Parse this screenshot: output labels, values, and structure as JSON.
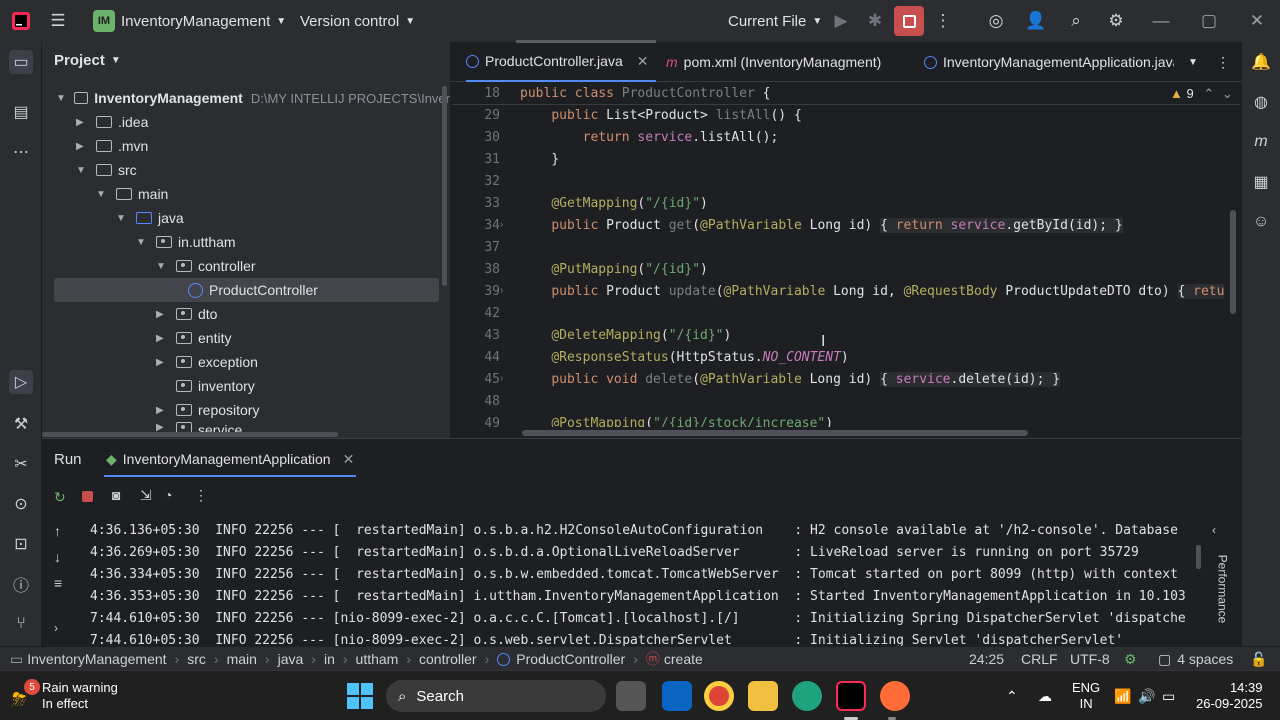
{
  "titlebar": {
    "project": "InventoryManagement",
    "project_badge": "IM",
    "vcs": "Version control",
    "run_config": "Current File"
  },
  "project_panel": {
    "title": "Project",
    "items": [
      {
        "label": "InventoryManagement",
        "path": "D:\\MY INTELLIJ PROJECTS\\Inver"
      },
      {
        "label": ".idea"
      },
      {
        "label": ".mvn"
      },
      {
        "label": "src"
      },
      {
        "label": "main"
      },
      {
        "label": "java"
      },
      {
        "label": "in.uttham"
      },
      {
        "label": "controller"
      },
      {
        "label": "ProductController"
      },
      {
        "label": "dto"
      },
      {
        "label": "entity"
      },
      {
        "label": "exception"
      },
      {
        "label": "inventory"
      },
      {
        "label": "repository"
      },
      {
        "label": "service"
      }
    ]
  },
  "tabs": [
    {
      "label": "ProductController.java"
    },
    {
      "label": "pom.xml (InventoryManagment)"
    },
    {
      "label": "InventoryManagementApplication.java"
    }
  ],
  "editor": {
    "warnings": "9",
    "sticky_line": "18",
    "sticky_code": "public class ProductController {",
    "lines": [
      {
        "n": "29",
        "code": "    public List<Product> listAll() {"
      },
      {
        "n": "30",
        "code": "        return service.listAll();"
      },
      {
        "n": "31",
        "code": "    }"
      },
      {
        "n": "32",
        "code": ""
      },
      {
        "n": "33",
        "code": "    @GetMapping(\"/{id}\")"
      },
      {
        "n": "34",
        "code": "    public Product get(@PathVariable Long id) { return service.getById(id); }"
      },
      {
        "n": "37",
        "code": ""
      },
      {
        "n": "38",
        "code": "    @PutMapping(\"/{id}\")"
      },
      {
        "n": "39",
        "code": "    public Product update(@PathVariable Long id, @RequestBody ProductUpdateDTO dto) { retu"
      },
      {
        "n": "42",
        "code": ""
      },
      {
        "n": "43",
        "code": "    @DeleteMapping(\"/{id}\")"
      },
      {
        "n": "44",
        "code": "    @ResponseStatus(HttpStatus.NO_CONTENT)"
      },
      {
        "n": "45",
        "code": "    public void delete(@PathVariable Long id) { service.delete(id); }"
      },
      {
        "n": "48",
        "code": ""
      },
      {
        "n": "49",
        "code": "    @PostMapping(\"/{id}/stock/increase\")"
      }
    ]
  },
  "run": {
    "title": "Run",
    "config": "InventoryManagementApplication",
    "side_label": "Performance",
    "logs": [
      "4:36.136+05:30  INFO 22256 --- [  restartedMain] o.s.b.a.h2.H2ConsoleAutoConfiguration    : H2 console available at '/h2-console'. Database",
      "4:36.269+05:30  INFO 22256 --- [  restartedMain] o.s.b.d.a.OptionalLiveReloadServer       : LiveReload server is running on port 35729",
      "4:36.334+05:30  INFO 22256 --- [  restartedMain] o.s.b.w.embedded.tomcat.TomcatWebServer  : Tomcat started on port 8099 (http) with context",
      "4:36.353+05:30  INFO 22256 --- [  restartedMain] i.uttham.InventoryManagementApplication  : Started InventoryManagementApplication in 10.103",
      "7:44.610+05:30  INFO 22256 --- [nio-8099-exec-2] o.a.c.c.C.[Tomcat].[localhost].[/]       : Initializing Spring DispatcherServlet 'dispatche",
      "7:44.610+05:30  INFO 22256 --- [nio-8099-exec-2] o.s.web.servlet.DispatcherServlet        : Initializing Servlet 'dispatcherServlet'"
    ]
  },
  "status": {
    "crumbs": [
      "InventoryManagement",
      "src",
      "main",
      "java",
      "in",
      "uttham",
      "controller",
      "ProductController",
      "create"
    ],
    "position": "24:25",
    "line_sep": "CRLF",
    "encoding": "UTF-8",
    "indent": "4 spaces"
  },
  "taskbar": {
    "weather_title": "Rain warning",
    "weather_sub": "In effect",
    "weather_badge": "5",
    "search": "Search",
    "lang1": "ENG",
    "lang2": "IN",
    "time": "14:39",
    "date": "26-09-2025"
  }
}
